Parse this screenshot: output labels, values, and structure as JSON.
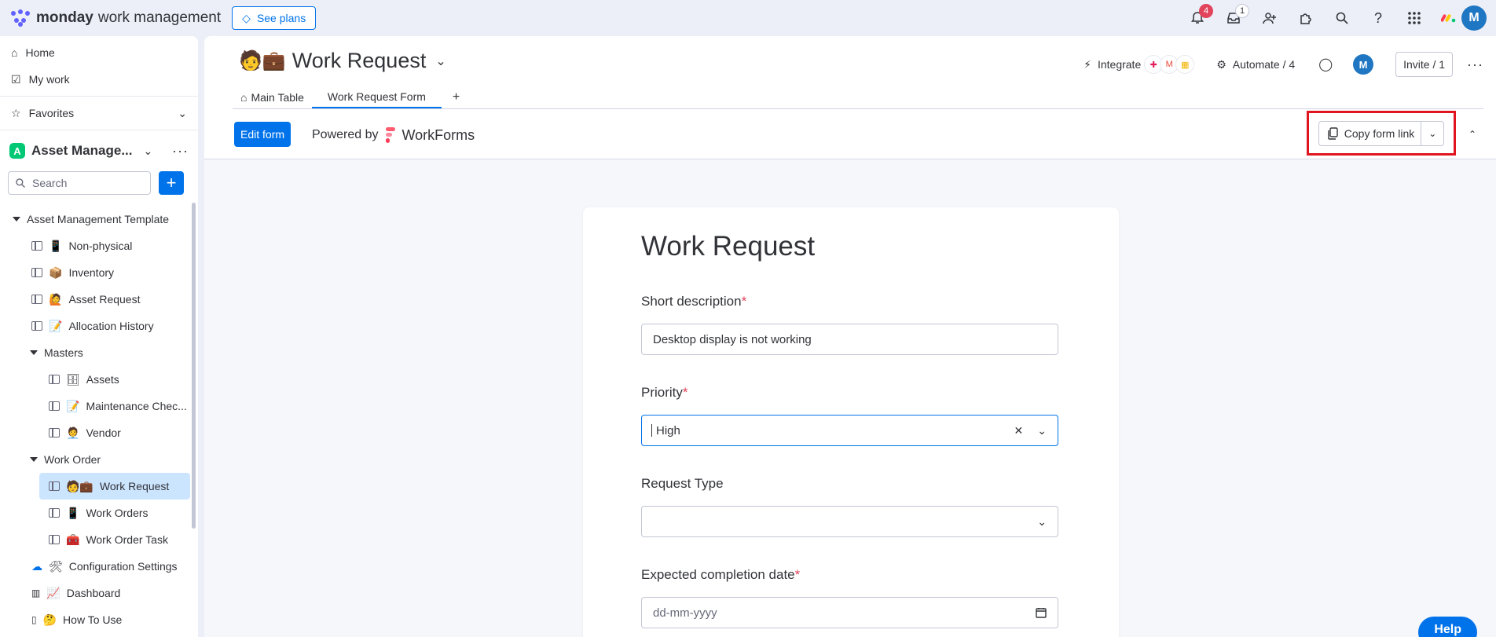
{
  "topbar": {
    "brand": "monday",
    "brand_sub": "work management",
    "see_plans": "See plans",
    "notifications_count": "4",
    "inbox_count": "1",
    "avatar_initial": "M"
  },
  "sidebar": {
    "home": "Home",
    "my_work": "My work",
    "favorites": "Favorites",
    "workspace_badge": "A",
    "workspace_name": "Asset Manage...",
    "search_placeholder": "Search",
    "tree": [
      {
        "label": "Asset Management Template",
        "emoji": ""
      },
      {
        "label": "Non-physical",
        "emoji": "📱"
      },
      {
        "label": "Inventory",
        "emoji": "📦"
      },
      {
        "label": "Asset Request",
        "emoji": "🙋"
      },
      {
        "label": "Allocation History",
        "emoji": "📝"
      },
      {
        "label": "Masters",
        "emoji": ""
      },
      {
        "label": "Assets",
        "emoji": "🗄"
      },
      {
        "label": "Maintenance Chec...",
        "emoji": "📝"
      },
      {
        "label": "Vendor",
        "emoji": "🧑‍💼"
      },
      {
        "label": "Work Order",
        "emoji": ""
      },
      {
        "label": "Work Request",
        "emoji": "🧑💼"
      },
      {
        "label": "Work Orders",
        "emoji": "📱"
      },
      {
        "label": "Work Order Task",
        "emoji": "🧰"
      },
      {
        "label": "Configuration Settings",
        "emoji": "🛠"
      },
      {
        "label": "Dashboard",
        "emoji": "📈"
      },
      {
        "label": "How To Use",
        "emoji": "🤔"
      }
    ]
  },
  "board": {
    "title": "Work Request",
    "title_emoji": "🧑💼",
    "integrate": "Integrate",
    "automate": "Automate / 4",
    "avatar_initial": "M",
    "invite": "Invite / 1",
    "tabs": [
      "Main Table",
      "Work Request Form"
    ],
    "add_tab": "+"
  },
  "formbar": {
    "edit_form": "Edit form",
    "powered_by": "Powered by",
    "workforms": "WorkForms",
    "copy_form_link": "Copy form link"
  },
  "form": {
    "title": "Work Request",
    "fields": {
      "short_description": {
        "label": "Short description",
        "value": "Desktop display is not working"
      },
      "priority": {
        "label": "Priority",
        "value": "High"
      },
      "request_type": {
        "label": "Request Type",
        "value": ""
      },
      "expected_date": {
        "label": "Expected completion date",
        "placeholder": "dd-mm-yyyy"
      }
    },
    "required_mark": "*"
  },
  "help": "Help",
  "colors": {
    "accent": "#0073ea",
    "highlight": "#e0151f",
    "active_row": "#cce5ff"
  }
}
